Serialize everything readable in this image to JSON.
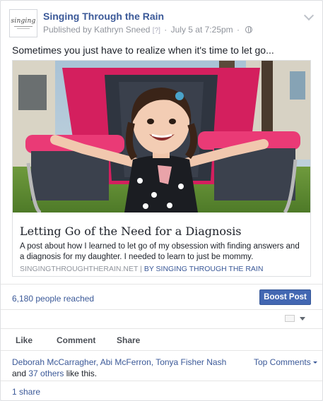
{
  "post": {
    "page_name": "Singing Through the Rain",
    "logo_text": "singing",
    "published_prefix": "Published by",
    "author": "Kathryn Sneed",
    "help_marker": "[?]",
    "separator": "·",
    "date": "July 5 at 7:25pm",
    "privacy_icon": "globe-icon",
    "menu_icon": "chevron-down-icon",
    "text": "Sometimes you just have to realize when it's time to let go..."
  },
  "link": {
    "image_subject": "toddler-girl-in-pink-camp-chair",
    "title": "Letting Go of the Need for a Diagnosis",
    "description": "A post about how I learned to let go of my obsession with finding answers and a diagnosis for my daughter. I needed to learn to just be mommy.",
    "source_domain": "SINGINGTHROUGHTHERAIN.NET",
    "source_sep": "|",
    "source_by": "BY SINGING THROUGH THE RAIN"
  },
  "insights": {
    "reach": "6,180 people reached",
    "boost_label": "Boost Post"
  },
  "actions": {
    "like": "Like",
    "comment": "Comment",
    "share": "Share"
  },
  "social": {
    "likers": "Deborah McCarragher, Abi McFerron, Tonya Fisher Nash",
    "and": "and",
    "others": "37 others",
    "like_this": "like this.",
    "top_comments": "Top Comments",
    "shares": "1 share"
  },
  "colors": {
    "link_blue": "#3b5998",
    "boost_blue": "#4267b2",
    "chair_pink": "#e02a6b"
  }
}
